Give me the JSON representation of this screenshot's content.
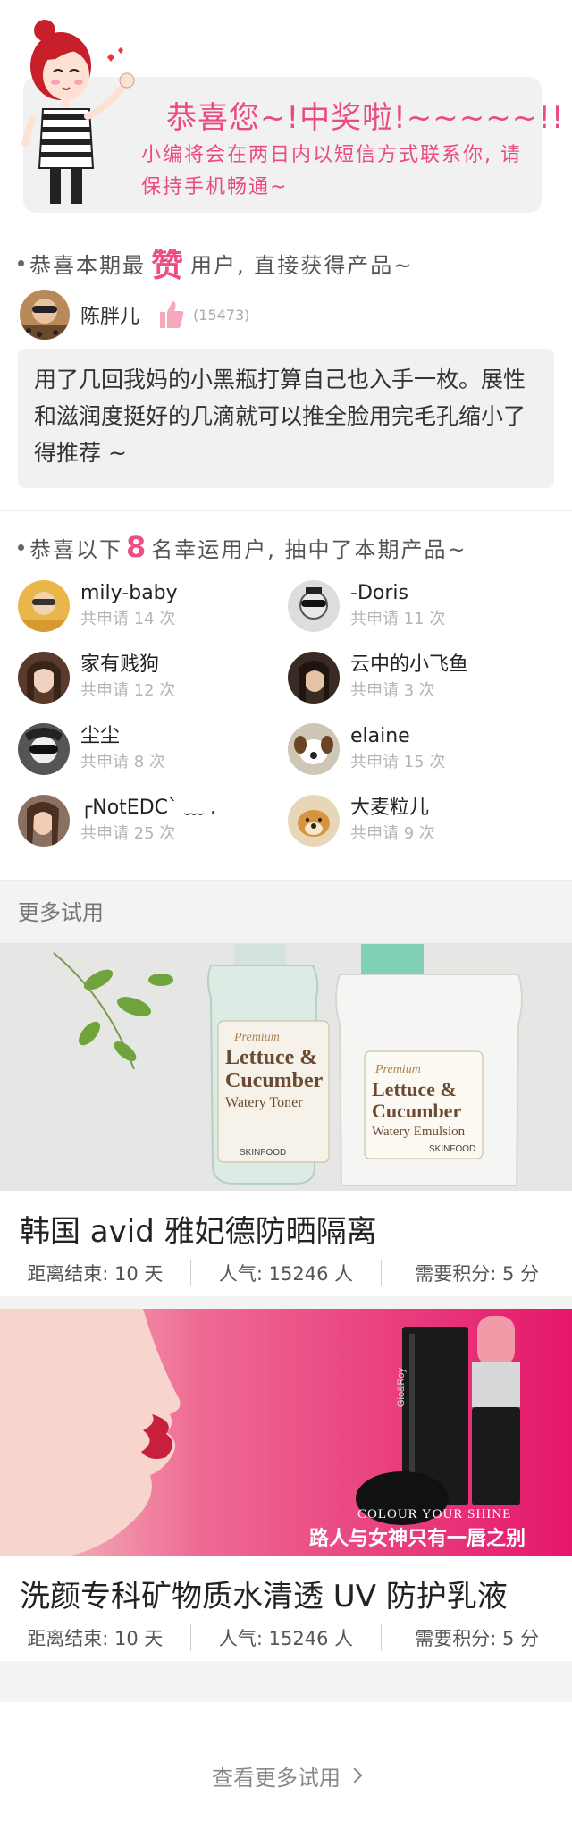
{
  "banner": {
    "title": "恭喜您~!中奖啦!~~~~~!!",
    "message": "小编将会在两日内以短信方式联系你, 请保持手机畅通~"
  },
  "top_like": {
    "heading_pre": "恭喜本期最",
    "heading_highlight": "赞",
    "heading_post": "用户, 直接获得产品~",
    "user": {
      "name": "陈胖儿",
      "likes": "(15473)"
    },
    "quote": "用了几回我妈的小黑瓶打算自己也入手一枚。展性和滋润度挺好的几滴就可以推全脸用完毛孔缩小了得推荐 ~"
  },
  "lucky": {
    "heading_pre": "恭喜以下",
    "heading_num": "8",
    "heading_post": "名幸运用户, 抽中了本期产品~",
    "users": [
      {
        "name": "mily-baby",
        "count": "共申请 14 次"
      },
      {
        "name": " -Doris",
        "count": "共申请 11 次"
      },
      {
        "name": "家有贱狗",
        "count": "共申请 12 次"
      },
      {
        "name": "云中的小飞鱼",
        "count": "共申请 3 次"
      },
      {
        "name": "尘尘",
        "count": "共申请 8 次"
      },
      {
        "name": "elaine",
        "count": "共申请 15 次"
      },
      {
        "name": "┌NotEDC` ﹏ .",
        "count": "共申请 25 次"
      },
      {
        "name": "大麦粒儿",
        "count": "共申请 9 次"
      }
    ]
  },
  "more": {
    "heading": "更多试用"
  },
  "trials": [
    {
      "title": "韩国 avid 雅妃德防晒隔离",
      "end": "距离结束: 10 天",
      "popularity": "人气: 15246 人",
      "points": "需要积分: 5 分",
      "image_text": {
        "brand1": "Premium",
        "line1": "Lettuce &",
        "line2": "Cucumber",
        "line3": "Watery Toner",
        "line3b": "Watery Emulsion",
        "maker": "SKINFOOD"
      }
    },
    {
      "title": "洗颜专科矿物质水清透 UV 防护乳液",
      "end": "距离结束: 10 天",
      "popularity": "人气: 15246 人",
      "points": "需要积分: 5 分",
      "image_text": {
        "slogan_en": "COLOUR YOUR SHINE",
        "slogan_cn": "路人与女神只有一唇之别",
        "brand": "Gio&Roy"
      }
    }
  ],
  "footer": {
    "view_more": "查看更多试用"
  },
  "colors": {
    "accent": "#ee4d86",
    "gray_bg": "#f3f3f3",
    "lip_bg": "#e5176b"
  }
}
